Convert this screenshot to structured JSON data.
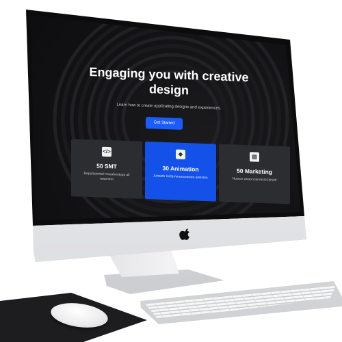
{
  "hero": {
    "title": "Engaging you with creative design",
    "subtitle": "Learn how to create applicating designs and experiences.",
    "cta_label": "Get Started"
  },
  "cards": [
    {
      "title": "50 SMT",
      "description": "Repulacental Insuabontops ali totament",
      "icon": "code-icon",
      "highlighted": false
    },
    {
      "title": "30 Animation",
      "description": "Amaste Iestemmunceswee alivision",
      "icon": "layers-icon",
      "highlighted": true
    },
    {
      "title": "50 Marketing",
      "description": "Nutson anaon tervesio beseit",
      "icon": "document-icon",
      "highlighted": false
    }
  ],
  "colors": {
    "screen_background": "#121214",
    "accent": "#1a5cff",
    "card": "#2c2d30",
    "card_highlight": "#1451e8"
  }
}
